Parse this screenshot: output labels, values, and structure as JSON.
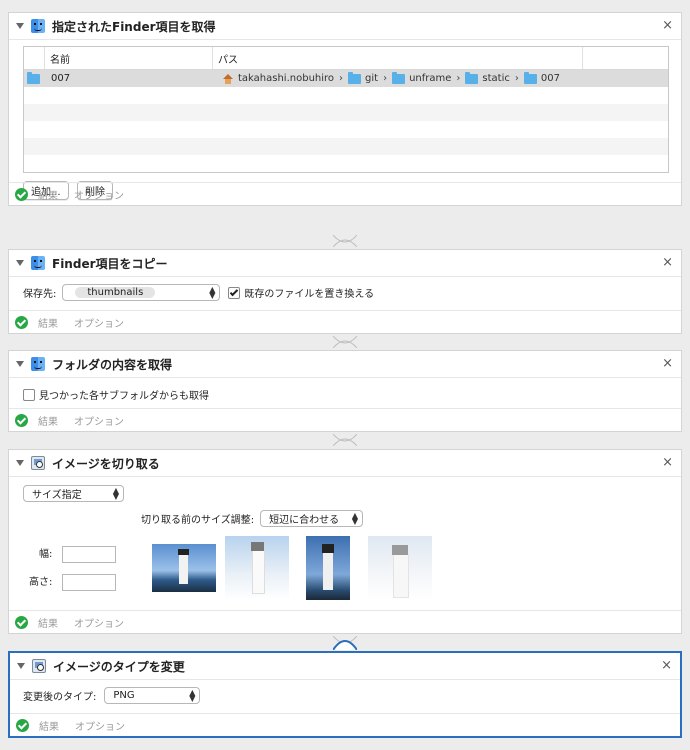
{
  "actions": [
    {
      "title": "指定されたFinder項目を取得",
      "result": "結果",
      "options": "オプション"
    },
    {
      "title": "Finder項目をコピー",
      "result": "結果",
      "options": "オプション"
    },
    {
      "title": "フォルダの内容を取得",
      "result": "結果",
      "options": "オプション"
    },
    {
      "title": "イメージを切り取る",
      "result": "結果",
      "options": "オプション"
    },
    {
      "title": "イメージのタイプを変更",
      "result": "結果",
      "options": "オプション"
    }
  ],
  "close_glyph": "×",
  "get_items": {
    "col_name": "名前",
    "col_path": "パス",
    "row": {
      "name": "007",
      "path": [
        "takahashi.nobuhiro",
        "git",
        "unframe",
        "static",
        "007"
      ]
    },
    "add_button": "追加...",
    "remove_button": "削除"
  },
  "copy": {
    "dest_label": "保存先:",
    "dest_value": "thumbnails",
    "replace_label": "既存のファイルを置き換える",
    "replace_checked": true
  },
  "folder": {
    "subfolder_label": "見つかった各サブフォルダからも取得",
    "subfolder_checked": false
  },
  "crop": {
    "mode_value": "サイズ指定",
    "pre_label": "切り取る前のサイズ調整:",
    "pre_value": "短辺に合わせる",
    "width_label": "幅:",
    "height_label": "高さ:"
  },
  "change_type": {
    "type_label": "変更後のタイプ:",
    "type_value": "PNG"
  },
  "colors": {
    "accent": "#2a6fbf",
    "success": "#27a844",
    "folder": "#58b0e8"
  }
}
